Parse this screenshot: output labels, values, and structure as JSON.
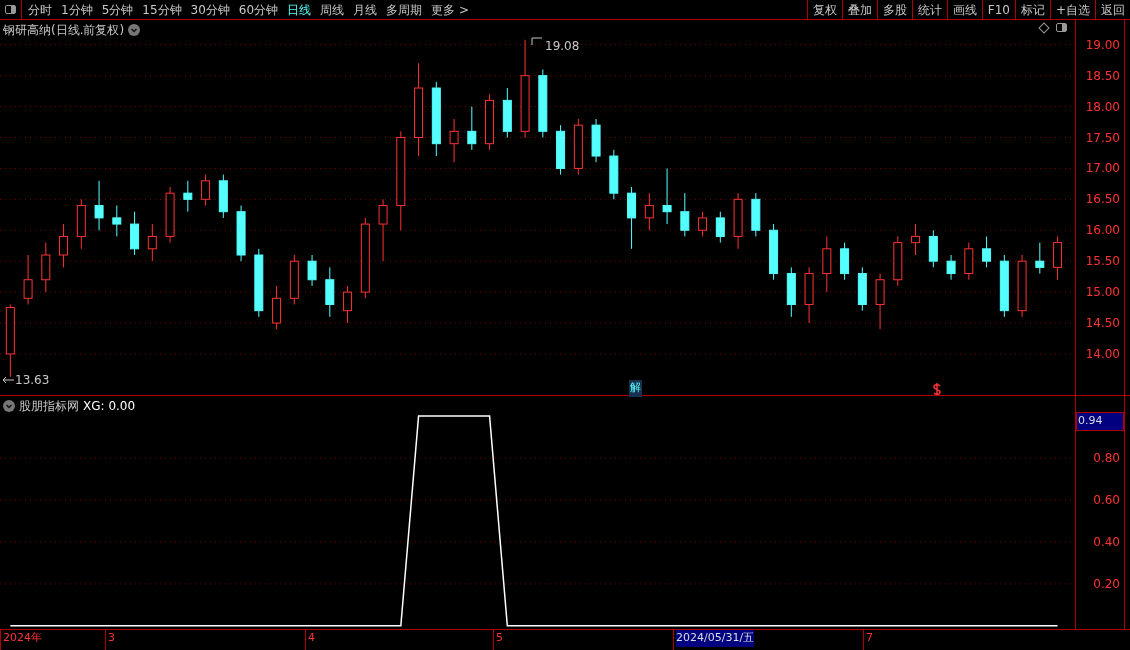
{
  "toolbar": {
    "periods": [
      {
        "label": "分时",
        "selected": false
      },
      {
        "label": "1分钟",
        "selected": false
      },
      {
        "label": "5分钟",
        "selected": false
      },
      {
        "label": "15分钟",
        "selected": false
      },
      {
        "label": "30分钟",
        "selected": false
      },
      {
        "label": "60分钟",
        "selected": false
      },
      {
        "label": "日线",
        "selected": true
      },
      {
        "label": "周线",
        "selected": false
      },
      {
        "label": "月线",
        "selected": false
      },
      {
        "label": "多周期",
        "selected": false
      },
      {
        "label": "更多 >",
        "selected": false
      }
    ],
    "actions": [
      "复权",
      "叠加",
      "多股",
      "统计",
      "画线",
      "F10",
      "标记",
      "+自选",
      "返回"
    ]
  },
  "price_panel": {
    "title": "钢研高纳(日线.前复权)",
    "high_label": "19.08",
    "low_label": "13.63",
    "event_marker": "解",
    "chart_data": {
      "type": "candlestick",
      "grid": true,
      "ylim": [
        13.32,
        19.4
      ],
      "yticks": [
        {
          "value": 19,
          "label": "19.00"
        },
        {
          "value": 18.5,
          "label": "18.50"
        },
        {
          "value": 18,
          "label": "18.00"
        },
        {
          "value": 17.5,
          "label": "17.50"
        },
        {
          "value": 17,
          "label": "17.00"
        },
        {
          "value": 16.5,
          "label": "16.50"
        },
        {
          "value": 16,
          "label": "16.00"
        },
        {
          "value": 15.5,
          "label": "15.50"
        },
        {
          "value": 15,
          "label": "15.00"
        },
        {
          "value": 14.5,
          "label": "14.50"
        },
        {
          "value": 14,
          "label": "14.00"
        }
      ],
      "ohlc": [
        [
          14.0,
          14.8,
          13.63,
          14.75
        ],
        [
          14.9,
          15.6,
          14.8,
          15.2
        ],
        [
          15.2,
          15.8,
          15.0,
          15.6
        ],
        [
          15.6,
          16.1,
          15.4,
          15.9
        ],
        [
          15.9,
          16.5,
          15.7,
          16.4
        ],
        [
          16.4,
          16.8,
          16.0,
          16.2
        ],
        [
          16.2,
          16.4,
          15.9,
          16.1
        ],
        [
          16.1,
          16.3,
          15.6,
          15.7
        ],
        [
          15.7,
          16.1,
          15.5,
          15.9
        ],
        [
          15.9,
          16.7,
          15.8,
          16.6
        ],
        [
          16.6,
          16.8,
          16.3,
          16.5
        ],
        [
          16.5,
          16.9,
          16.4,
          16.8
        ],
        [
          16.8,
          16.9,
          16.2,
          16.3
        ],
        [
          16.3,
          16.4,
          15.5,
          15.6
        ],
        [
          15.6,
          15.7,
          14.6,
          14.7
        ],
        [
          14.5,
          15.1,
          14.4,
          14.9
        ],
        [
          14.9,
          15.6,
          14.8,
          15.5
        ],
        [
          15.5,
          15.6,
          15.1,
          15.2
        ],
        [
          15.2,
          15.4,
          14.6,
          14.8
        ],
        [
          14.7,
          15.1,
          14.5,
          15.0
        ],
        [
          15.0,
          16.2,
          14.9,
          16.1
        ],
        [
          16.1,
          16.5,
          15.5,
          16.4
        ],
        [
          16.4,
          17.6,
          16.0,
          17.5
        ],
        [
          17.5,
          18.7,
          17.2,
          18.3
        ],
        [
          18.3,
          18.4,
          17.2,
          17.4
        ],
        [
          17.4,
          17.8,
          17.1,
          17.6
        ],
        [
          17.6,
          18.0,
          17.3,
          17.4
        ],
        [
          17.4,
          18.2,
          17.3,
          18.1
        ],
        [
          18.1,
          18.3,
          17.5,
          17.6
        ],
        [
          17.6,
          19.08,
          17.5,
          18.5
        ],
        [
          18.5,
          18.6,
          17.5,
          17.6
        ],
        [
          17.6,
          17.7,
          16.9,
          17.0
        ],
        [
          17.0,
          17.8,
          16.9,
          17.7
        ],
        [
          17.7,
          17.8,
          17.1,
          17.2
        ],
        [
          17.2,
          17.3,
          16.5,
          16.6
        ],
        [
          16.6,
          16.7,
          15.7,
          16.2
        ],
        [
          16.2,
          16.6,
          16.0,
          16.4
        ],
        [
          16.4,
          17.0,
          16.1,
          16.3
        ],
        [
          16.3,
          16.6,
          15.9,
          16.0
        ],
        [
          16.0,
          16.3,
          15.9,
          16.2
        ],
        [
          16.2,
          16.3,
          15.8,
          15.9
        ],
        [
          15.9,
          16.6,
          15.7,
          16.5
        ],
        [
          16.5,
          16.6,
          15.9,
          16.0
        ],
        [
          16.0,
          16.1,
          15.2,
          15.3
        ],
        [
          15.3,
          15.4,
          14.6,
          14.8
        ],
        [
          14.8,
          15.4,
          14.5,
          15.3
        ],
        [
          15.3,
          15.9,
          15.0,
          15.7
        ],
        [
          15.7,
          15.8,
          15.2,
          15.3
        ],
        [
          15.3,
          15.4,
          14.7,
          14.8
        ],
        [
          14.8,
          15.3,
          14.4,
          15.2
        ],
        [
          15.2,
          15.9,
          15.1,
          15.8
        ],
        [
          15.8,
          16.1,
          15.6,
          15.9
        ],
        [
          15.9,
          16.0,
          15.4,
          15.5
        ],
        [
          15.5,
          15.6,
          15.2,
          15.3
        ],
        [
          15.3,
          15.8,
          15.2,
          15.7
        ],
        [
          15.7,
          15.9,
          15.4,
          15.5
        ],
        [
          15.5,
          15.6,
          14.6,
          14.7
        ],
        [
          14.7,
          15.6,
          14.6,
          15.5
        ],
        [
          15.5,
          15.8,
          15.3,
          15.4
        ],
        [
          15.4,
          15.9,
          15.2,
          15.8
        ]
      ]
    }
  },
  "indicator_panel": {
    "title": "股朋指标网",
    "readout": ": 0.00",
    "cursor_value": "0.94",
    "chart_data": {
      "type": "line",
      "grid": true,
      "categories": [
        null,
        null,
        null,
        null,
        null,
        null,
        null,
        null,
        null,
        null,
        null,
        null,
        null,
        null,
        null,
        null,
        null,
        null,
        null,
        null,
        null,
        null,
        null,
        null,
        null,
        null,
        null,
        null,
        null,
        null,
        null,
        null,
        null,
        null,
        null,
        null,
        null,
        null,
        null,
        null,
        null,
        null,
        null,
        null,
        null,
        null,
        null,
        null,
        null,
        null,
        null,
        null,
        null,
        null,
        null,
        null,
        null,
        null,
        null,
        null
      ],
      "ylim": [
        -0.015,
        1.1
      ],
      "yticks": [
        {
          "value": 0.8,
          "label": "0.80"
        },
        {
          "value": 0.6,
          "label": "0.60"
        },
        {
          "value": 0.4,
          "label": "0.40"
        },
        {
          "value": 0.2,
          "label": "0.20"
        }
      ],
      "series": [
        {
          "name": "XG",
          "color": "#ffffff",
          "values": [
            0,
            0,
            0,
            0,
            0,
            0,
            0,
            0,
            0,
            0,
            0,
            0,
            0,
            0,
            0,
            0,
            0,
            0,
            0,
            0,
            0,
            0,
            0,
            1,
            1,
            1,
            1,
            1,
            0,
            0,
            0,
            0,
            0,
            0,
            0,
            0,
            0,
            0,
            0,
            0,
            0,
            0,
            0,
            0,
            0,
            0,
            0,
            0,
            0,
            0,
            0,
            0,
            0,
            0,
            0,
            0,
            0,
            0,
            0,
            0
          ]
        }
      ]
    }
  },
  "date_axis": [
    {
      "label": "2024年",
      "selected": false
    },
    {
      "label": "3",
      "selected": false
    },
    {
      "label": "4",
      "selected": false
    },
    {
      "label": "5",
      "selected": false
    },
    {
      "label": "2024/05/31/五",
      "selected": true
    },
    {
      "label": "7",
      "selected": false
    }
  ]
}
